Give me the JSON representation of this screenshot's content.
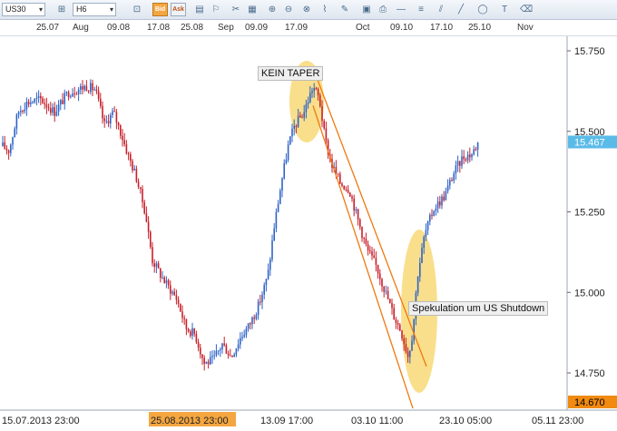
{
  "toolbar": {
    "symbol": "US30",
    "timeframe": "H6",
    "bid_label": "Bid",
    "ask_label": "Ask"
  },
  "annotations": {
    "kein_taper": "KEIN TAPER",
    "spekulation": "Spekulation um US Shutdown"
  },
  "colors": {
    "up": "#2e63c7",
    "down": "#c8202a",
    "channel": "#f07810",
    "highlight": "#f7d25a",
    "current": "#5bbbe8"
  },
  "chart_data": {
    "type": "candlestick",
    "top_axis": [
      "25.07",
      "Aug",
      "09.08",
      "17.08",
      "25.08",
      "Sep",
      "09.09",
      "17.09",
      "Oct",
      "09.10",
      "17.10",
      "25.10",
      "Nov"
    ],
    "bottom_axis": [
      "15.07.2013 23:00",
      "25.08.2013 23:00",
      "13.09 17:00",
      "03.10 11:00",
      "23.10 05:00",
      "05.11 23:00"
    ],
    "bottom_axis_highlight": "25.08.2013 23:00",
    "y_ticks": [
      "15.750",
      "15.500",
      "15.250",
      "15.000",
      "14.750"
    ],
    "y_tick_values": [
      15750,
      15500,
      15250,
      15000,
      14750
    ],
    "current_price": "15.467",
    "current_price_value": 15467,
    "min_label": "14.670",
    "min_label_value": 14670,
    "ylim": [
      14670,
      15830
    ],
    "path": [
      [
        0,
        15460
      ],
      [
        10,
        15440
      ],
      [
        20,
        15560
      ],
      [
        30,
        15590
      ],
      [
        45,
        15600
      ],
      [
        60,
        15560
      ],
      [
        75,
        15620
      ],
      [
        95,
        15640
      ],
      [
        105,
        15630
      ],
      [
        115,
        15520
      ],
      [
        125,
        15560
      ],
      [
        135,
        15480
      ],
      [
        142,
        15420
      ],
      [
        150,
        15360
      ],
      [
        160,
        15250
      ],
      [
        168,
        15100
      ],
      [
        180,
        15040
      ],
      [
        195,
        14980
      ],
      [
        205,
        14890
      ],
      [
        215,
        14870
      ],
      [
        225,
        14780
      ],
      [
        235,
        14790
      ],
      [
        245,
        14840
      ],
      [
        255,
        14800
      ],
      [
        265,
        14860
      ],
      [
        275,
        14900
      ],
      [
        285,
        14960
      ],
      [
        295,
        15050
      ],
      [
        302,
        15200
      ],
      [
        310,
        15340
      ],
      [
        318,
        15460
      ],
      [
        325,
        15520
      ],
      [
        335,
        15560
      ],
      [
        345,
        15640
      ],
      [
        352,
        15600
      ],
      [
        358,
        15480
      ],
      [
        365,
        15400
      ],
      [
        375,
        15340
      ],
      [
        385,
        15320
      ],
      [
        395,
        15220
      ],
      [
        405,
        15130
      ],
      [
        415,
        15080
      ],
      [
        425,
        15000
      ],
      [
        435,
        14920
      ],
      [
        442,
        14880
      ],
      [
        450,
        14800
      ],
      [
        455,
        14880
      ],
      [
        460,
        15050
      ],
      [
        468,
        15180
      ],
      [
        478,
        15260
      ],
      [
        490,
        15300
      ],
      [
        500,
        15370
      ],
      [
        510,
        15420
      ],
      [
        520,
        15430
      ],
      [
        528,
        15470
      ]
    ]
  }
}
